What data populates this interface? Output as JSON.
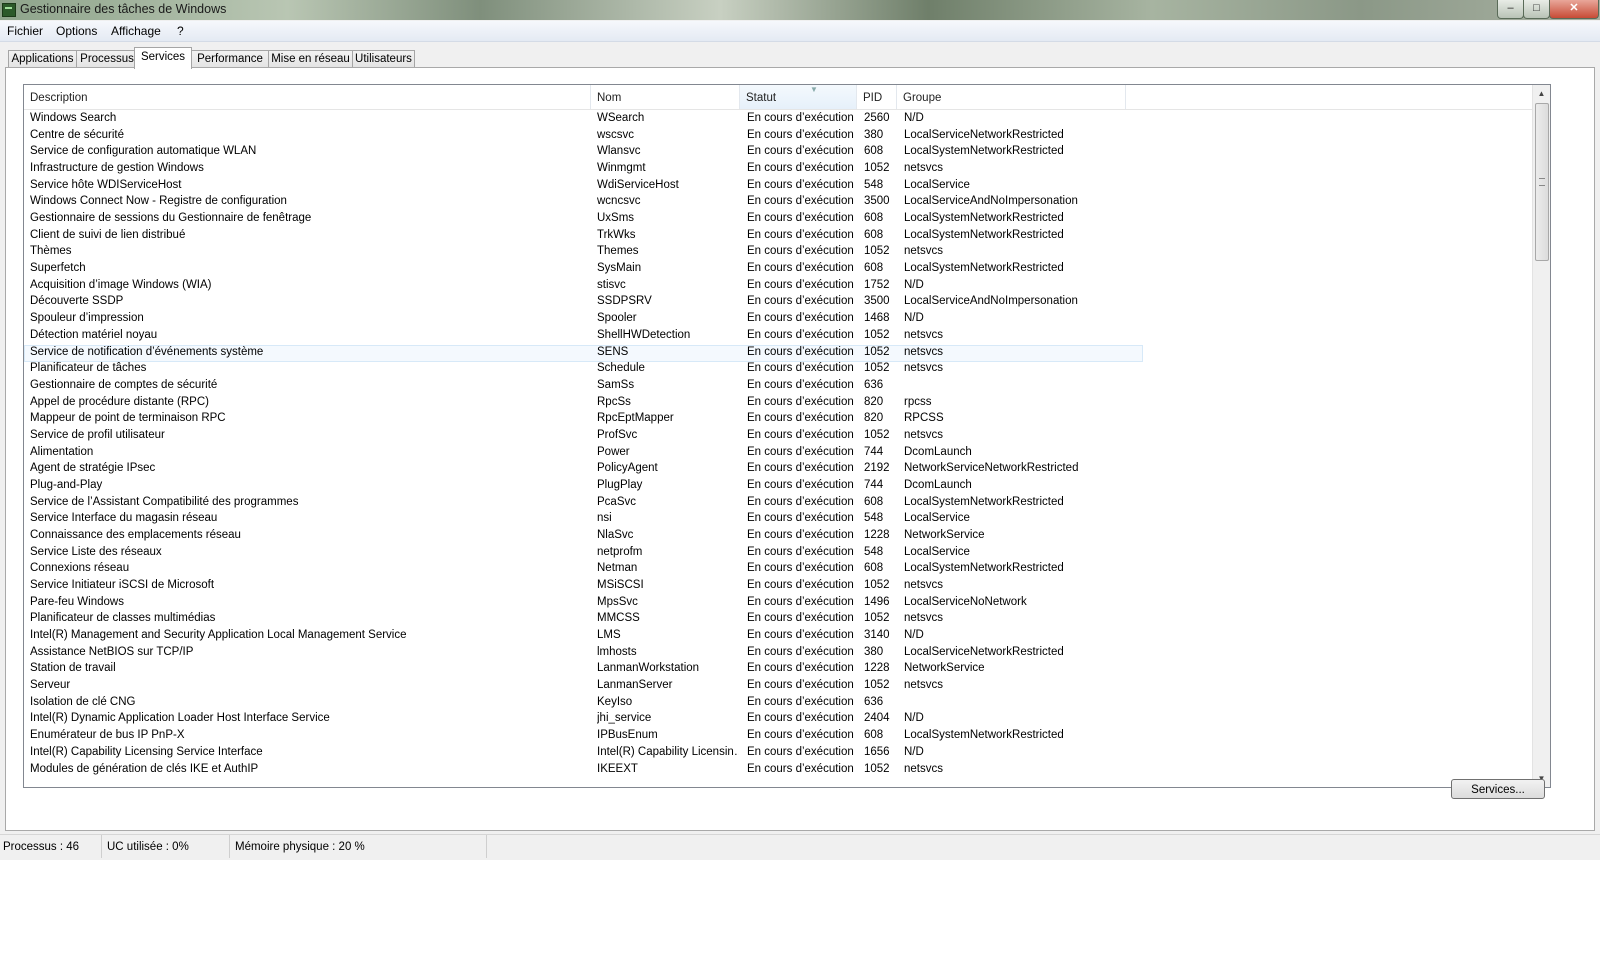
{
  "window": {
    "title": "Gestionnaire des tâches de Windows",
    "controls": {
      "minimize": "–",
      "maximize": "□",
      "close": "✕"
    }
  },
  "menu": [
    "Fichier",
    "Options",
    "Affichage",
    "?"
  ],
  "tabs": [
    {
      "label": "Applications",
      "active": false
    },
    {
      "label": "Processus",
      "active": false
    },
    {
      "label": "Services",
      "active": true
    },
    {
      "label": "Performance",
      "active": false
    },
    {
      "label": "Mise en réseau",
      "active": false
    },
    {
      "label": "Utilisateurs",
      "active": false
    }
  ],
  "table": {
    "columns": [
      "Description",
      "Nom",
      "Statut",
      "PID",
      "Groupe"
    ],
    "sorted_column": "Statut",
    "selected_row": 14,
    "rows": [
      [
        "Windows Search",
        "WSearch",
        "En cours d’exécution",
        "2560",
        "N/D"
      ],
      [
        "Centre de sécurité",
        "wscsvc",
        "En cours d’exécution",
        "380",
        "LocalServiceNetworkRestricted"
      ],
      [
        "Service de configuration automatique WLAN",
        "Wlansvc",
        "En cours d’exécution",
        "608",
        "LocalSystemNetworkRestricted"
      ],
      [
        "Infrastructure de gestion Windows",
        "Winmgmt",
        "En cours d’exécution",
        "1052",
        "netsvcs"
      ],
      [
        "Service hôte WDIServiceHost",
        "WdiServiceHost",
        "En cours d’exécution",
        "548",
        "LocalService"
      ],
      [
        "Windows Connect Now - Registre de configuration",
        "wcncsvc",
        "En cours d’exécution",
        "3500",
        "LocalServiceAndNoImpersonation"
      ],
      [
        "Gestionnaire de sessions du Gestionnaire de fenêtrage",
        "UxSms",
        "En cours d’exécution",
        "608",
        "LocalSystemNetworkRestricted"
      ],
      [
        "Client de suivi de lien distribué",
        "TrkWks",
        "En cours d’exécution",
        "608",
        "LocalSystemNetworkRestricted"
      ],
      [
        "Thèmes",
        "Themes",
        "En cours d’exécution",
        "1052",
        "netsvcs"
      ],
      [
        "Superfetch",
        "SysMain",
        "En cours d’exécution",
        "608",
        "LocalSystemNetworkRestricted"
      ],
      [
        "Acquisition d’image Windows (WIA)",
        "stisvc",
        "En cours d’exécution",
        "1752",
        "N/D"
      ],
      [
        "Découverte SSDP",
        "SSDPSRV",
        "En cours d’exécution",
        "3500",
        "LocalServiceAndNoImpersonation"
      ],
      [
        "Spouleur d’impression",
        "Spooler",
        "En cours d’exécution",
        "1468",
        "N/D"
      ],
      [
        "Détection matériel noyau",
        "ShellHWDetection",
        "En cours d’exécution",
        "1052",
        "netsvcs"
      ],
      [
        "Service de notification d’événements système",
        "SENS",
        "En cours d’exécution",
        "1052",
        "netsvcs"
      ],
      [
        "Planificateur de tâches",
        "Schedule",
        "En cours d’exécution",
        "1052",
        "netsvcs"
      ],
      [
        "Gestionnaire de comptes de sécurité",
        "SamSs",
        "En cours d’exécution",
        "636",
        ""
      ],
      [
        "Appel de procédure distante (RPC)",
        "RpcSs",
        "En cours d’exécution",
        "820",
        "rpcss"
      ],
      [
        "Mappeur de point de terminaison RPC",
        "RpcEptMapper",
        "En cours d’exécution",
        "820",
        "RPCSS"
      ],
      [
        "Service de profil utilisateur",
        "ProfSvc",
        "En cours d’exécution",
        "1052",
        "netsvcs"
      ],
      [
        "Alimentation",
        "Power",
        "En cours d’exécution",
        "744",
        "DcomLaunch"
      ],
      [
        "Agent de stratégie IPsec",
        "PolicyAgent",
        "En cours d’exécution",
        "2192",
        "NetworkServiceNetworkRestricted"
      ],
      [
        "Plug-and-Play",
        "PlugPlay",
        "En cours d’exécution",
        "744",
        "DcomLaunch"
      ],
      [
        "Service de l’Assistant Compatibilité des programmes",
        "PcaSvc",
        "En cours d’exécution",
        "608",
        "LocalSystemNetworkRestricted"
      ],
      [
        "Service Interface du magasin réseau",
        "nsi",
        "En cours d’exécution",
        "548",
        "LocalService"
      ],
      [
        "Connaissance des emplacements réseau",
        "NlaSvc",
        "En cours d’exécution",
        "1228",
        "NetworkService"
      ],
      [
        "Service Liste des réseaux",
        "netprofm",
        "En cours d’exécution",
        "548",
        "LocalService"
      ],
      [
        "Connexions réseau",
        "Netman",
        "En cours d’exécution",
        "608",
        "LocalSystemNetworkRestricted"
      ],
      [
        "Service Initiateur iSCSI de Microsoft",
        "MSiSCSI",
        "En cours d’exécution",
        "1052",
        "netsvcs"
      ],
      [
        "Pare-feu Windows",
        "MpsSvc",
        "En cours d’exécution",
        "1496",
        "LocalServiceNoNetwork"
      ],
      [
        "Planificateur de classes multimédias",
        "MMCSS",
        "En cours d’exécution",
        "1052",
        "netsvcs"
      ],
      [
        "Intel(R) Management and Security Application Local Management Service",
        "LMS",
        "En cours d’exécution",
        "3140",
        "N/D"
      ],
      [
        "Assistance NetBIOS sur TCP/IP",
        "lmhosts",
        "En cours d’exécution",
        "380",
        "LocalServiceNetworkRestricted"
      ],
      [
        "Station de travail",
        "LanmanWorkstation",
        "En cours d’exécution",
        "1228",
        "NetworkService"
      ],
      [
        "Serveur",
        "LanmanServer",
        "En cours d’exécution",
        "1052",
        "netsvcs"
      ],
      [
        "Isolation de clé CNG",
        "KeyIso",
        "En cours d’exécution",
        "636",
        ""
      ],
      [
        "Intel(R) Dynamic Application Loader Host Interface Service",
        "jhi_service",
        "En cours d’exécution",
        "2404",
        "N/D"
      ],
      [
        "Énumérateur de bus IP PnP-X",
        "IPBusEnum",
        "En cours d’exécution",
        "608",
        "LocalSystemNetworkRestricted"
      ],
      [
        "Intel(R) Capability Licensing Service Interface",
        "Intel(R) Capability Licensin…",
        "En cours d’exécution",
        "1656",
        "N/D"
      ],
      [
        "Modules de génération de clés IKE et AuthIP",
        "IKEEXT",
        "En cours d’exécution",
        "1052",
        "netsvcs"
      ]
    ]
  },
  "services_button": "Services...",
  "statusbar": {
    "processes": "Processus : 46",
    "cpu": "UC utilisée : 0%",
    "memory": "Mémoire physique : 20 %"
  },
  "icons": {
    "scroll_up": "▲",
    "scroll_down": "▼",
    "sort_arrow": "▼"
  }
}
